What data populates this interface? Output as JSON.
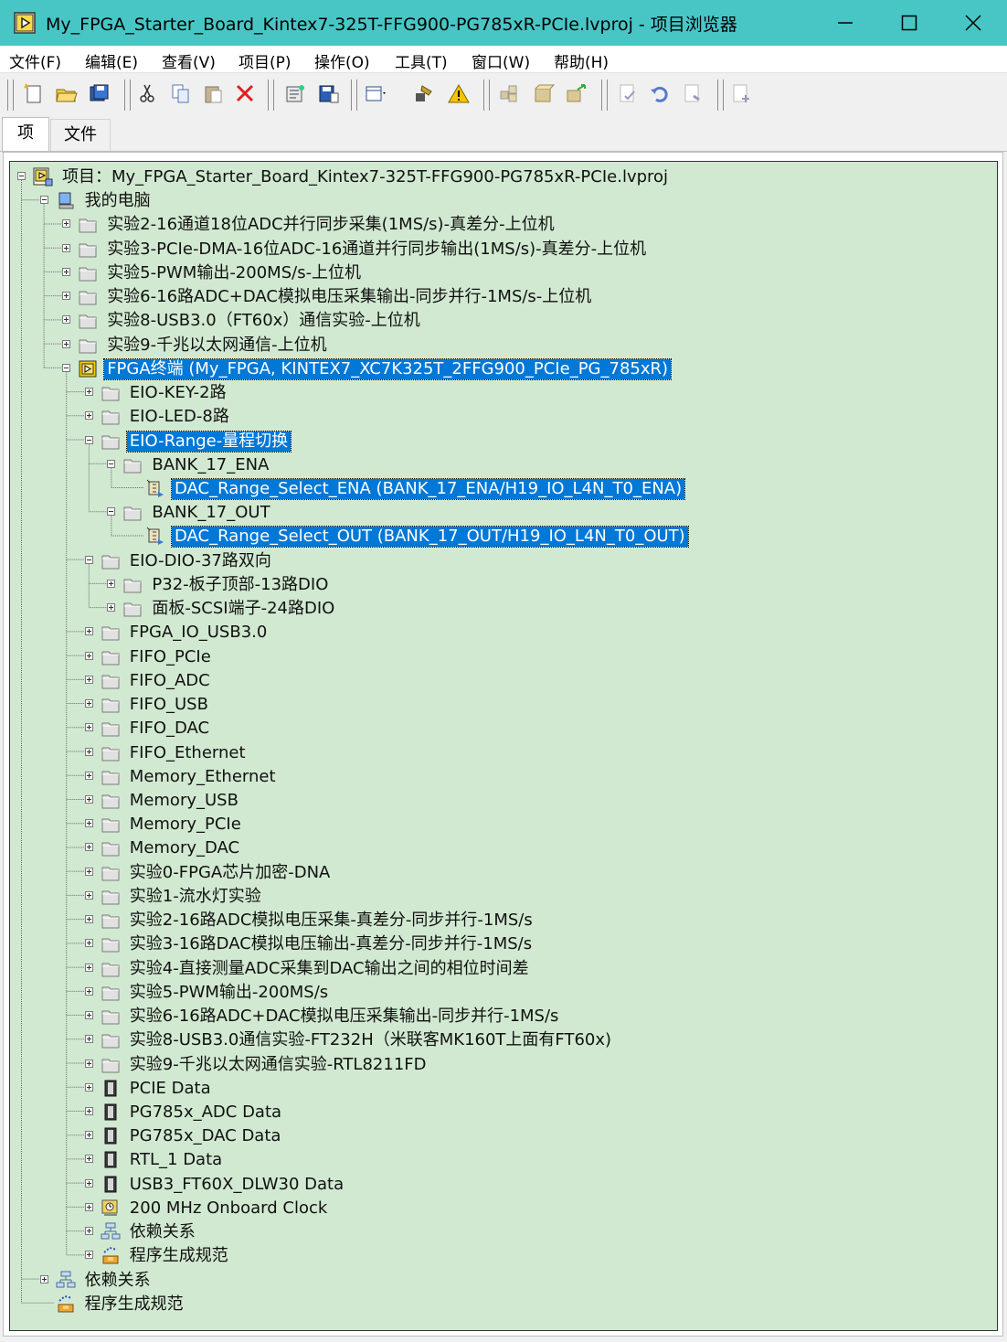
{
  "window": {
    "title": "My_FPGA_Starter_Board_Kintex7-325T-FFG900-PG785xR-PCIe.lvproj - 项目浏览器",
    "app_icon": "labview-project-icon",
    "titlebar_color": "#48c6c6",
    "controls": [
      "minimize-icon",
      "maximize-icon",
      "close-icon"
    ]
  },
  "menu": [
    "文件(F)",
    "编辑(E)",
    "查看(V)",
    "项目(P)",
    "操作(O)",
    "工具(T)",
    "窗口(W)",
    "帮助(H)"
  ],
  "toolbar": {
    "buttons": [
      {
        "name": "new-icon"
      },
      {
        "name": "open-icon"
      },
      {
        "name": "save-all-icon"
      },
      {
        "name": "cut-icon"
      },
      {
        "name": "copy-icon"
      },
      {
        "name": "paste-icon"
      },
      {
        "name": "delete-icon"
      },
      {
        "name": "project-properties-icon"
      },
      {
        "name": "save-project-icon"
      },
      {
        "name": "view-dropdown-icon"
      },
      {
        "name": "tools-icon"
      },
      {
        "name": "warning-icon"
      },
      {
        "name": "build-icon"
      },
      {
        "name": "package-icon"
      },
      {
        "name": "deploy-icon"
      },
      {
        "name": "check-icon"
      },
      {
        "name": "undo-icon"
      },
      {
        "name": "refresh-icon"
      },
      {
        "name": "add-file-icon"
      }
    ]
  },
  "tabs": [
    {
      "label": "项",
      "active": true
    },
    {
      "label": "文件",
      "active": false
    }
  ],
  "tree": {
    "background": "#d1e9d1",
    "selection_color": "#0078d7",
    "items": [
      {
        "label": "项目：My_FPGA_Starter_Board_Kintex7-325T-FFG900-PG785xR-PCIe.lvproj",
        "depth": 0,
        "icon": "project",
        "exp": "minus"
      },
      {
        "label": "我的电脑",
        "depth": 1,
        "icon": "computer",
        "exp": "minus"
      },
      {
        "label": "实验2-16通道18位ADC并行同步采集(1MS/s)-真差分-上位机",
        "depth": 2,
        "icon": "folder",
        "exp": "plus"
      },
      {
        "label": "实验3-PCIe-DMA-16位ADC-16通道并行同步输出(1MS/s)-真差分-上位机",
        "depth": 2,
        "icon": "folder",
        "exp": "plus"
      },
      {
        "label": "实验5-PWM输出-200MS/s-上位机",
        "depth": 2,
        "icon": "folder",
        "exp": "plus"
      },
      {
        "label": "实验6-16路ADC+DAC模拟电压采集输出-同步并行-1MS/s-上位机",
        "depth": 2,
        "icon": "folder",
        "exp": "plus"
      },
      {
        "label": "实验8-USB3.0（FT60x）通信实验-上位机",
        "depth": 2,
        "icon": "folder",
        "exp": "plus"
      },
      {
        "label": "实验9-千兆以太网通信-上位机",
        "depth": 2,
        "icon": "folder",
        "exp": "plus"
      },
      {
        "label": "FPGA终端 (My_FPGA, KINTEX7_XC7K325T_2FFG900_PCIe_PG_785xR)",
        "depth": 2,
        "icon": "fpga-target",
        "exp": "minus",
        "selected": true
      },
      {
        "label": "EIO-KEY-2路",
        "depth": 3,
        "icon": "folder",
        "exp": "plus"
      },
      {
        "label": "EIO-LED-8路",
        "depth": 3,
        "icon": "folder",
        "exp": "plus"
      },
      {
        "label": "EIO-Range-量程切换",
        "depth": 3,
        "icon": "folder",
        "exp": "minus",
        "selected": true
      },
      {
        "label": "BANK_17_ENA",
        "depth": 4,
        "icon": "folder",
        "exp": "minus"
      },
      {
        "label": "DAC_Range_Select_ENA (BANK_17_ENA/H19_IO_L4N_T0_ENA)",
        "depth": 5,
        "icon": "io-node",
        "exp": "none",
        "selected": true
      },
      {
        "label": "BANK_17_OUT",
        "depth": 4,
        "icon": "folder",
        "exp": "minus"
      },
      {
        "label": "DAC_Range_Select_OUT (BANK_17_OUT/H19_IO_L4N_T0_OUT)",
        "depth": 5,
        "icon": "io-node",
        "exp": "none",
        "selected": true
      },
      {
        "label": "EIO-DIO-37路双向",
        "depth": 3,
        "icon": "folder",
        "exp": "minus"
      },
      {
        "label": "P32-板子顶部-13路DIO",
        "depth": 4,
        "icon": "folder",
        "exp": "plus"
      },
      {
        "label": "面板-SCSI端子-24路DIO",
        "depth": 4,
        "icon": "folder",
        "exp": "plus"
      },
      {
        "label": "FPGA_IO_USB3.0",
        "depth": 3,
        "icon": "folder",
        "exp": "plus"
      },
      {
        "label": "FIFO_PCIe",
        "depth": 3,
        "icon": "folder",
        "exp": "plus"
      },
      {
        "label": "FIFO_ADC",
        "depth": 3,
        "icon": "folder",
        "exp": "plus"
      },
      {
        "label": "FIFO_USB",
        "depth": 3,
        "icon": "folder",
        "exp": "plus"
      },
      {
        "label": "FIFO_DAC",
        "depth": 3,
        "icon": "folder",
        "exp": "plus"
      },
      {
        "label": "FIFO_Ethernet",
        "depth": 3,
        "icon": "folder",
        "exp": "plus"
      },
      {
        "label": "Memory_Ethernet",
        "depth": 3,
        "icon": "folder",
        "exp": "plus"
      },
      {
        "label": "Memory_USB",
        "depth": 3,
        "icon": "folder",
        "exp": "plus"
      },
      {
        "label": "Memory_PCIe",
        "depth": 3,
        "icon": "folder",
        "exp": "plus"
      },
      {
        "label": "Memory_DAC",
        "depth": 3,
        "icon": "folder",
        "exp": "plus"
      },
      {
        "label": "实验0-FPGA芯片加密-DNA",
        "depth": 3,
        "icon": "folder",
        "exp": "plus"
      },
      {
        "label": "实验1-流水灯实验",
        "depth": 3,
        "icon": "folder",
        "exp": "plus"
      },
      {
        "label": "实验2-16路ADC模拟电压采集-真差分-同步并行-1MS/s",
        "depth": 3,
        "icon": "folder",
        "exp": "plus"
      },
      {
        "label": "实验3-16路DAC模拟电压输出-真差分-同步并行-1MS/s",
        "depth": 3,
        "icon": "folder",
        "exp": "plus"
      },
      {
        "label": "实验4-直接测量ADC采集到DAC输出之间的相位时间差",
        "depth": 3,
        "icon": "folder",
        "exp": "plus"
      },
      {
        "label": "实验5-PWM输出-200MS/s",
        "depth": 3,
        "icon": "folder",
        "exp": "plus"
      },
      {
        "label": "实验6-16路ADC+DAC模拟电压采集输出-同步并行-1MS/s",
        "depth": 3,
        "icon": "folder",
        "exp": "plus"
      },
      {
        "label": "实验8-USB3.0通信实验-FT232H（米联客MK160T上面有FT60x)",
        "depth": 3,
        "icon": "folder",
        "exp": "plus"
      },
      {
        "label": "实验9-千兆以太网通信实验-RTL8211FD",
        "depth": 3,
        "icon": "folder",
        "exp": "plus"
      },
      {
        "label": "PCIE Data",
        "depth": 3,
        "icon": "clip",
        "exp": "plus"
      },
      {
        "label": "PG785x_ADC Data",
        "depth": 3,
        "icon": "clip",
        "exp": "plus"
      },
      {
        "label": "PG785x_DAC Data",
        "depth": 3,
        "icon": "clip",
        "exp": "plus"
      },
      {
        "label": "RTL_1 Data",
        "depth": 3,
        "icon": "clip",
        "exp": "plus"
      },
      {
        "label": "USB3_FT60X_DLW30 Data",
        "depth": 3,
        "icon": "clip",
        "exp": "plus"
      },
      {
        "label": "200 MHz Onboard Clock",
        "depth": 3,
        "icon": "clock",
        "exp": "plus"
      },
      {
        "label": "依赖关系",
        "depth": 3,
        "icon": "dependencies",
        "exp": "plus"
      },
      {
        "label": "程序生成规范",
        "depth": 3,
        "icon": "build-spec",
        "exp": "plus"
      },
      {
        "label": "依赖关系",
        "depth": 1,
        "icon": "dependencies",
        "exp": "plus"
      },
      {
        "label": "程序生成规范",
        "depth": 1,
        "icon": "build-spec",
        "exp": "none"
      }
    ]
  }
}
